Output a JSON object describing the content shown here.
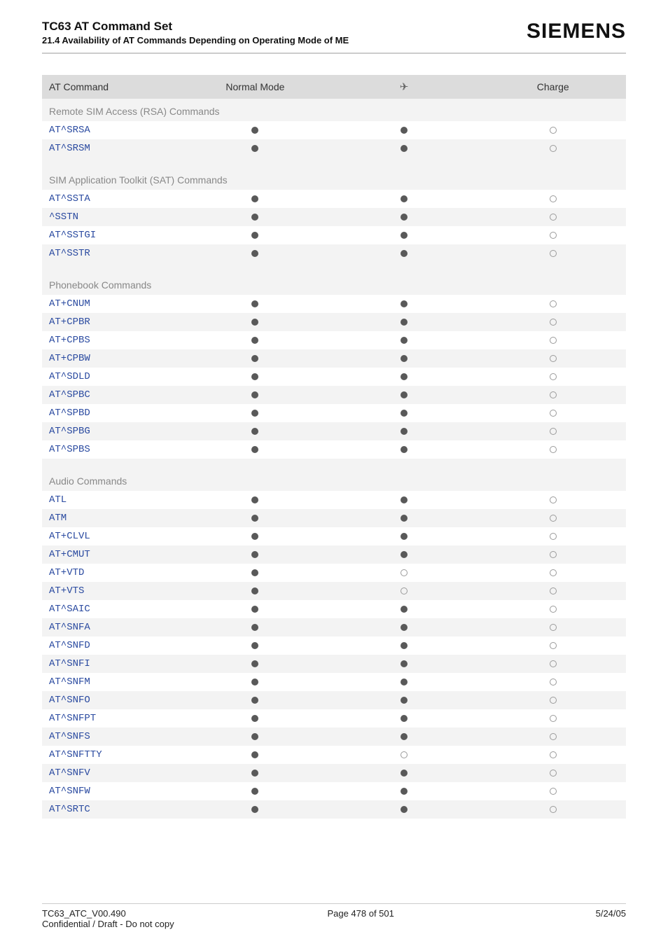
{
  "header": {
    "title": "TC63 AT Command Set",
    "subtitle": "21.4 Availability of AT Commands Depending on Operating Mode of ME",
    "brand": "SIEMENS"
  },
  "table": {
    "columns": [
      "AT Command",
      "Normal Mode",
      "airplane",
      "Charge"
    ],
    "airplane_glyph": "✈",
    "sections": [
      {
        "title": "Remote SIM Access (RSA) Commands",
        "rows": [
          {
            "cmd": "AT^SRSA",
            "normal": "filled",
            "air": "filled",
            "charge": "empty"
          },
          {
            "cmd": "AT^SRSM",
            "normal": "filled",
            "air": "filled",
            "charge": "empty"
          }
        ]
      },
      {
        "title": "SIM Application Toolkit (SAT) Commands",
        "rows": [
          {
            "cmd": "AT^SSTA",
            "normal": "filled",
            "air": "filled",
            "charge": "empty"
          },
          {
            "cmd": "^SSTN",
            "normal": "filled",
            "air": "filled",
            "charge": "empty"
          },
          {
            "cmd": "AT^SSTGI",
            "normal": "filled",
            "air": "filled",
            "charge": "empty"
          },
          {
            "cmd": "AT^SSTR",
            "normal": "filled",
            "air": "filled",
            "charge": "empty"
          }
        ]
      },
      {
        "title": "Phonebook Commands",
        "rows": [
          {
            "cmd": "AT+CNUM",
            "normal": "filled",
            "air": "filled",
            "charge": "empty"
          },
          {
            "cmd": "AT+CPBR",
            "normal": "filled",
            "air": "filled",
            "charge": "empty"
          },
          {
            "cmd": "AT+CPBS",
            "normal": "filled",
            "air": "filled",
            "charge": "empty"
          },
          {
            "cmd": "AT+CPBW",
            "normal": "filled",
            "air": "filled",
            "charge": "empty"
          },
          {
            "cmd": "AT^SDLD",
            "normal": "filled",
            "air": "filled",
            "charge": "empty"
          },
          {
            "cmd": "AT^SPBC",
            "normal": "filled",
            "air": "filled",
            "charge": "empty"
          },
          {
            "cmd": "AT^SPBD",
            "normal": "filled",
            "air": "filled",
            "charge": "empty"
          },
          {
            "cmd": "AT^SPBG",
            "normal": "filled",
            "air": "filled",
            "charge": "empty"
          },
          {
            "cmd": "AT^SPBS",
            "normal": "filled",
            "air": "filled",
            "charge": "empty"
          }
        ]
      },
      {
        "title": "Audio Commands",
        "rows": [
          {
            "cmd": "ATL",
            "normal": "filled",
            "air": "filled",
            "charge": "empty"
          },
          {
            "cmd": "ATM",
            "normal": "filled",
            "air": "filled",
            "charge": "empty"
          },
          {
            "cmd": "AT+CLVL",
            "normal": "filled",
            "air": "filled",
            "charge": "empty"
          },
          {
            "cmd": "AT+CMUT",
            "normal": "filled",
            "air": "filled",
            "charge": "empty"
          },
          {
            "cmd": "AT+VTD",
            "normal": "filled",
            "air": "empty",
            "charge": "empty"
          },
          {
            "cmd": "AT+VTS",
            "normal": "filled",
            "air": "empty",
            "charge": "empty"
          },
          {
            "cmd": "AT^SAIC",
            "normal": "filled",
            "air": "filled",
            "charge": "empty"
          },
          {
            "cmd": "AT^SNFA",
            "normal": "filled",
            "air": "filled",
            "charge": "empty"
          },
          {
            "cmd": "AT^SNFD",
            "normal": "filled",
            "air": "filled",
            "charge": "empty"
          },
          {
            "cmd": "AT^SNFI",
            "normal": "filled",
            "air": "filled",
            "charge": "empty"
          },
          {
            "cmd": "AT^SNFM",
            "normal": "filled",
            "air": "filled",
            "charge": "empty"
          },
          {
            "cmd": "AT^SNFO",
            "normal": "filled",
            "air": "filled",
            "charge": "empty"
          },
          {
            "cmd": "AT^SNFPT",
            "normal": "filled",
            "air": "filled",
            "charge": "empty"
          },
          {
            "cmd": "AT^SNFS",
            "normal": "filled",
            "air": "filled",
            "charge": "empty"
          },
          {
            "cmd": "AT^SNFTTY",
            "normal": "filled",
            "air": "empty",
            "charge": "empty"
          },
          {
            "cmd": "AT^SNFV",
            "normal": "filled",
            "air": "filled",
            "charge": "empty"
          },
          {
            "cmd": "AT^SNFW",
            "normal": "filled",
            "air": "filled",
            "charge": "empty"
          },
          {
            "cmd": "AT^SRTC",
            "normal": "filled",
            "air": "filled",
            "charge": "empty"
          }
        ]
      }
    ]
  },
  "footer": {
    "left1": "TC63_ATC_V00.490",
    "left2": "Confidential / Draft - Do not copy",
    "center": "Page 478 of 501",
    "right": "5/24/05"
  }
}
